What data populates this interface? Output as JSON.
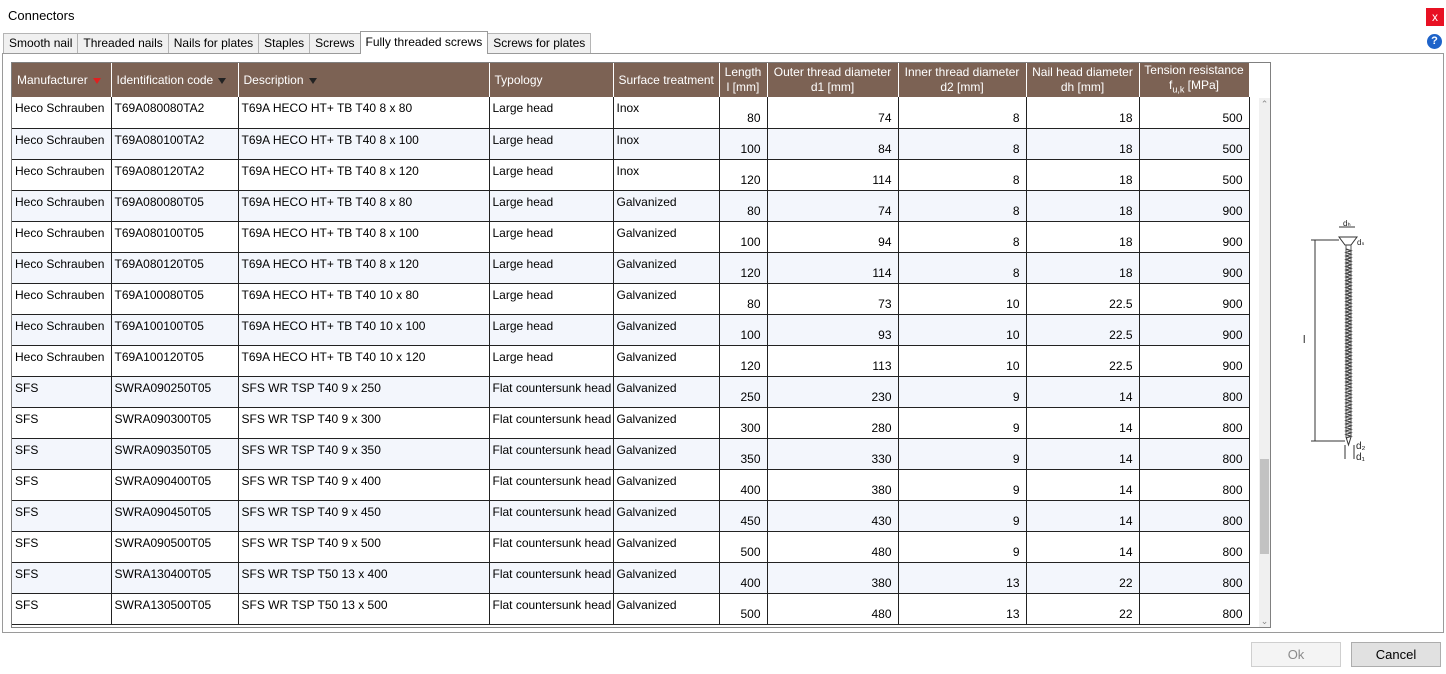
{
  "window": {
    "title": "Connectors",
    "close_label": "x",
    "help_label": "?"
  },
  "tabs": [
    {
      "label": "Smooth nail"
    },
    {
      "label": "Threaded nails"
    },
    {
      "label": "Nails for plates"
    },
    {
      "label": "Staples"
    },
    {
      "label": "Screws"
    },
    {
      "label": "Fully threaded screws",
      "active": true
    },
    {
      "label": "Screws for plates"
    }
  ],
  "table": {
    "headers": {
      "manufacturer": "Manufacturer",
      "id_code": "Identification code",
      "description": "Description",
      "typology": "Typology",
      "surface": "Surface treatment",
      "length_l1": "Length",
      "length_l2": "l [mm]",
      "outer_l1": "Outer thread diameter",
      "outer_l2": "d1 [mm]",
      "inner_l1": "Inner thread diameter",
      "inner_l2": "d2 [mm]",
      "head_l1": "Nail head diameter",
      "head_l2": "dh [mm]",
      "tension_l1": "Tension resistance",
      "tension_l2_main": "f",
      "tension_l2_sub": "u,k",
      "tension_l2_unit": " [MPa]"
    },
    "filters": {
      "manufacturer": "active",
      "id_code": "inactive",
      "description": "inactive"
    },
    "rows": [
      [
        "Heco Schrauben",
        "T69A080080TA2",
        "T69A HECO HT+ TB T40 8 x 80",
        "Large head",
        "Inox",
        "80",
        "74",
        "8",
        "18",
        "500"
      ],
      [
        "Heco Schrauben",
        "T69A080100TA2",
        "T69A HECO HT+ TB T40 8 x 100",
        "Large head",
        "Inox",
        "100",
        "84",
        "8",
        "18",
        "500"
      ],
      [
        "Heco Schrauben",
        "T69A080120TA2",
        "T69A HECO HT+ TB T40 8 x 120",
        "Large head",
        "Inox",
        "120",
        "114",
        "8",
        "18",
        "500"
      ],
      [
        "Heco Schrauben",
        "T69A080080T05",
        "T69A HECO HT+ TB T40 8 x 80",
        "Large head",
        "Galvanized",
        "80",
        "74",
        "8",
        "18",
        "900"
      ],
      [
        "Heco Schrauben",
        "T69A080100T05",
        "T69A HECO HT+ TB T40 8 x 100",
        "Large head",
        "Galvanized",
        "100",
        "94",
        "8",
        "18",
        "900"
      ],
      [
        "Heco Schrauben",
        "T69A080120T05",
        "T69A HECO HT+ TB T40 8 x 120",
        "Large head",
        "Galvanized",
        "120",
        "114",
        "8",
        "18",
        "900"
      ],
      [
        "Heco Schrauben",
        "T69A100080T05",
        "T69A HECO HT+ TB T40 10 x 80",
        "Large head",
        "Galvanized",
        "80",
        "73",
        "10",
        "22.5",
        "900"
      ],
      [
        "Heco Schrauben",
        "T69A100100T05",
        "T69A HECO HT+ TB T40 10 x 100",
        "Large head",
        "Galvanized",
        "100",
        "93",
        "10",
        "22.5",
        "900"
      ],
      [
        "Heco Schrauben",
        "T69A100120T05",
        "T69A HECO HT+ TB T40 10 x 120",
        "Large head",
        "Galvanized",
        "120",
        "113",
        "10",
        "22.5",
        "900"
      ],
      [
        "SFS",
        "SWRA090250T05",
        "SFS WR TSP T40 9 x 250",
        "Flat countersunk head",
        "Galvanized",
        "250",
        "230",
        "9",
        "14",
        "800"
      ],
      [
        "SFS",
        "SWRA090300T05",
        "SFS WR TSP T40 9 x 300",
        "Flat countersunk head",
        "Galvanized",
        "300",
        "280",
        "9",
        "14",
        "800"
      ],
      [
        "SFS",
        "SWRA090350T05",
        "SFS WR TSP T40 9 x 350",
        "Flat countersunk head",
        "Galvanized",
        "350",
        "330",
        "9",
        "14",
        "800"
      ],
      [
        "SFS",
        "SWRA090400T05",
        "SFS WR TSP T40 9 x 400",
        "Flat countersunk head",
        "Galvanized",
        "400",
        "380",
        "9",
        "14",
        "800"
      ],
      [
        "SFS",
        "SWRA090450T05",
        "SFS WR TSP T40 9 x 450",
        "Flat countersunk head",
        "Galvanized",
        "450",
        "430",
        "9",
        "14",
        "800"
      ],
      [
        "SFS",
        "SWRA090500T05",
        "SFS WR TSP T40 9 x 500",
        "Flat countersunk head",
        "Galvanized",
        "500",
        "480",
        "9",
        "14",
        "800"
      ],
      [
        "SFS",
        "SWRA130400T05",
        "SFS WR TSP T50 13 x 400",
        "Flat countersunk head",
        "Galvanized",
        "400",
        "380",
        "13",
        "22",
        "800"
      ],
      [
        "SFS",
        "SWRA130500T05",
        "SFS WR TSP T50 13 x 500",
        "Flat countersunk head",
        "Galvanized",
        "500",
        "480",
        "13",
        "22",
        "800"
      ]
    ],
    "scroll_fraction": 0.85
  },
  "diagram": {
    "label_dh": "dₕ",
    "label_ds": "dₛ",
    "label_l": "l",
    "label_d2": "d₂",
    "label_d1": "d₁"
  },
  "buttons": {
    "ok": "Ok",
    "cancel": "Cancel"
  },
  "colors": {
    "header_bg": "#7c6254",
    "filter_active": "#e02020",
    "close_bg": "#e81123",
    "help_bg": "#1e63c9"
  }
}
